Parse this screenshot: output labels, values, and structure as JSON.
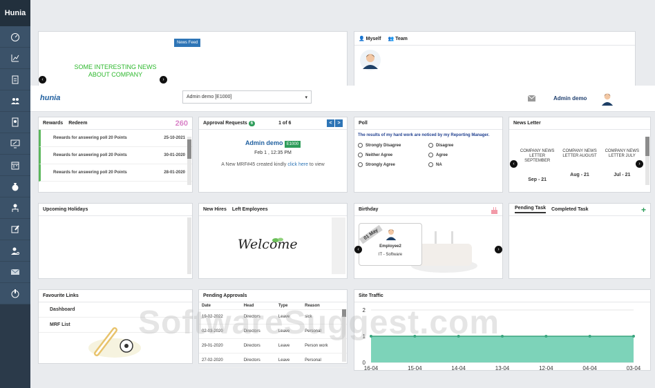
{
  "sidebar": {
    "brand": "Hunia",
    "items": [
      "dashboard-icon",
      "chart-icon",
      "clipboard-icon",
      "people-icon",
      "document-icon",
      "monitor-icon",
      "calendar-icon",
      "moneybag-icon",
      "org-icon",
      "edit-icon",
      "user-settings-icon",
      "mail-icon",
      "power-icon"
    ]
  },
  "news": {
    "text": "SOME INTERESTING NEWS ABOUT COMPANY",
    "tag": "News Feed"
  },
  "profile": {
    "tab_myself": "Myself",
    "tab_team": "Team"
  },
  "topbar": {
    "logo": "hunia",
    "select_value": "Admin demo [E1000]",
    "user_name": "Admin demo"
  },
  "rewards": {
    "tab1": "Rewards",
    "tab2": "Redeem",
    "points": "260",
    "rows": [
      {
        "label": "Rewards for answering poll 20 Points",
        "date": "25-10-2021"
      },
      {
        "label": "Rewards for answering poll 20 Points",
        "date": "30-01-2020"
      },
      {
        "label": "Rewards for answering poll 20 Points",
        "date": "28-01-2020"
      }
    ]
  },
  "approval": {
    "title": "Approval Requests",
    "count": "6",
    "pager": "1 of 6",
    "prev": "<",
    "next": ">",
    "name": "Admin demo",
    "emp": "E1000",
    "datetime": "Feb 1 , 12:35 PM",
    "msg_pre": "A New MRF#45 created kindly ",
    "link": "click here",
    "msg_post": " to view"
  },
  "poll": {
    "title": "Poll",
    "question": "The results of my hard work are noticed by my Reporting Manager.",
    "options": [
      "Strongly Disagree",
      "Disagree",
      "Neither Agree",
      "Agree",
      "Strongly Agree",
      "NA"
    ]
  },
  "newsletter": {
    "title": "News Letter",
    "items": [
      {
        "label": "COMPANY NEWS LETTER SEPTEMBER",
        "date": "Sep - 21"
      },
      {
        "label": "COMPANY NEWS LETTER AUGUST",
        "date": "Aug - 21"
      },
      {
        "label": "COMPANY NEWS LETTER JULY",
        "date": "Jul - 21"
      }
    ]
  },
  "holidays": {
    "title": "Upcoming Holidays"
  },
  "hires": {
    "tab1": "New Hires",
    "tab2": "Left Employees",
    "welcome": "Welcome"
  },
  "birthday": {
    "title": "Birthday",
    "ribbon": "01 May",
    "name": "Employee2",
    "dept": "IT - Software"
  },
  "tasks": {
    "tab1": "Pending Task",
    "tab2": "Completed Task",
    "add": "+"
  },
  "favourites": {
    "title": "Favourite Links",
    "links": [
      "Dashboard",
      "MRF List"
    ]
  },
  "pending": {
    "title": "Pending Approvals",
    "headers": [
      "Date",
      "Head",
      "Type",
      "Reason"
    ],
    "rows": [
      [
        "19-02-2022",
        "Directors",
        "Leave",
        "sick"
      ],
      [
        "02-03-2020",
        "Directors",
        "Leave",
        "Personal"
      ],
      [
        "29-01-2020",
        "Directors",
        "Leave",
        "Person work"
      ],
      [
        "27-02-2020",
        "Directors",
        "Leave",
        "Personal"
      ]
    ]
  },
  "traffic": {
    "title": "Site Traffic"
  },
  "chart_data": {
    "type": "area",
    "x": [
      "16-04",
      "15-04",
      "14-04",
      "13-04",
      "12-04",
      "04-04",
      "03-04"
    ],
    "values": [
      1,
      1,
      1,
      1,
      1,
      1,
      1
    ],
    "yticks": [
      "0",
      "1",
      "2"
    ],
    "ylim": [
      0,
      2
    ],
    "color": "#7dd3b9"
  },
  "watermark": "SoftwareSuggest.com"
}
